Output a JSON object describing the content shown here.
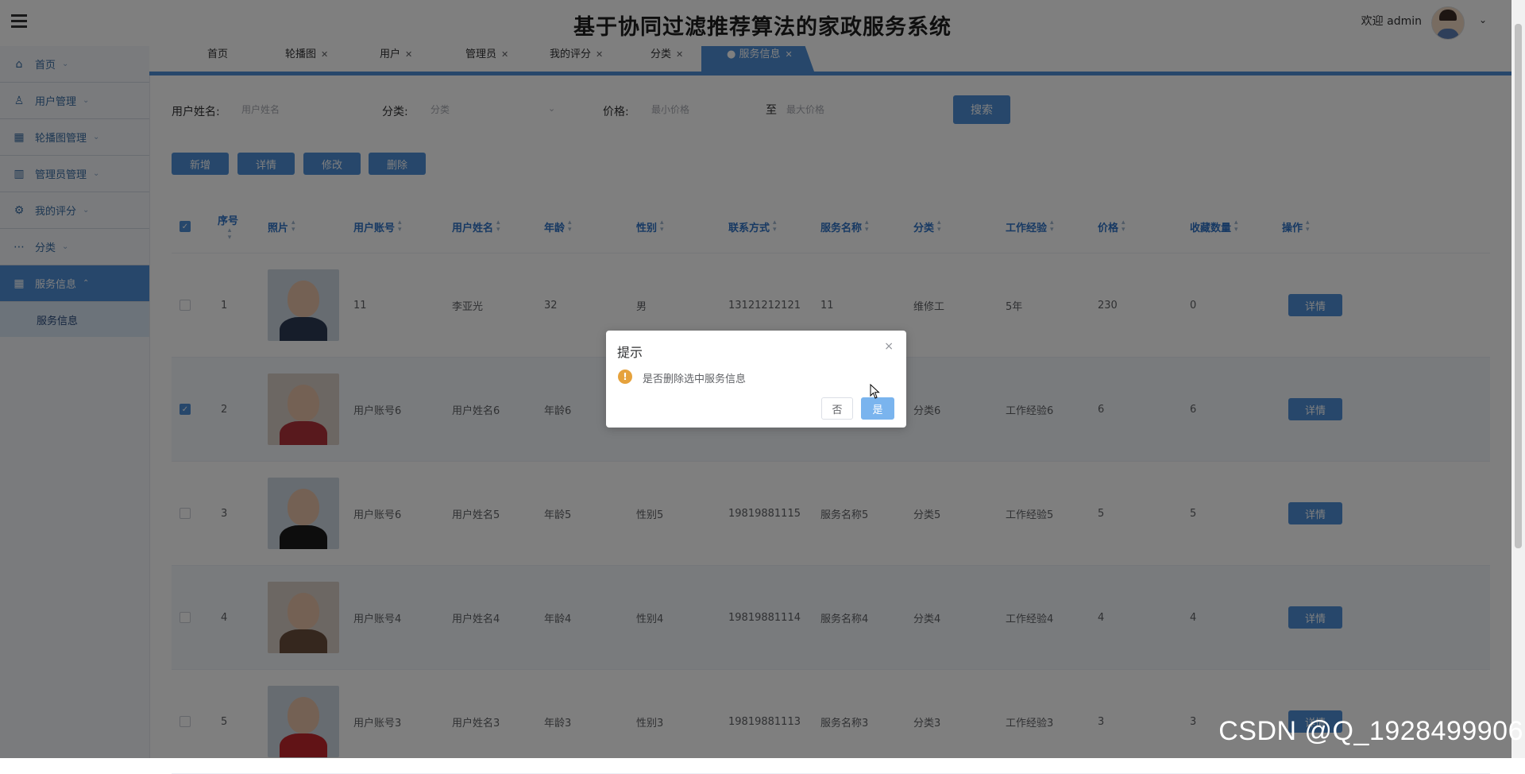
{
  "header": {
    "title": "基于协同过滤推荐算法的家政服务系统",
    "welcome": "欢迎 admin"
  },
  "sidebar": {
    "items": [
      {
        "label": "首页",
        "icon": "home-icon",
        "glyph": "⌂"
      },
      {
        "label": "用户管理",
        "icon": "user-icon",
        "glyph": "♙"
      },
      {
        "label": "轮播图管理",
        "icon": "grid-icon",
        "glyph": "▦"
      },
      {
        "label": "管理员管理",
        "icon": "dashboard-icon",
        "glyph": "▥"
      },
      {
        "label": "我的评分",
        "icon": "settings-icon",
        "glyph": "⚙"
      },
      {
        "label": "分类",
        "icon": "more-icon",
        "glyph": "⋯"
      },
      {
        "label": "服务信息",
        "icon": "grid-icon",
        "glyph": "▦"
      }
    ],
    "sub_item": "服务信息"
  },
  "tabs": [
    "首页",
    "轮播图",
    "用户",
    "管理员",
    "我的评分",
    "分类",
    "服务信息"
  ],
  "filters": {
    "name_label": "用户姓名:",
    "name_placeholder": "用户姓名",
    "category_label": "分类:",
    "category_placeholder": "分类",
    "price_label": "价格:",
    "min_placeholder": "最小价格",
    "range_sep": "至",
    "max_placeholder": "最大价格",
    "search": "搜索"
  },
  "actions": {
    "add": "新增",
    "detail": "详情",
    "edit": "修改",
    "delete": "删除"
  },
  "table": {
    "columns": [
      "序号",
      "照片",
      "用户账号",
      "用户姓名",
      "年龄",
      "性别",
      "联系方式",
      "服务名称",
      "分类",
      "工作经验",
      "价格",
      "收藏数量",
      "操作"
    ],
    "rows": [
      {
        "idx": "1",
        "account": "11",
        "name": "李亚光",
        "age": "32",
        "gender": "男",
        "phone": "13121212121",
        "service": "11",
        "category": "维修工",
        "experience": "5年",
        "price": "230",
        "favorites": "0",
        "checked": false,
        "cloth": "#2c3a55"
      },
      {
        "idx": "2",
        "account": "用户账号6",
        "name": "用户姓名6",
        "age": "年龄6",
        "gender": "",
        "phone": "",
        "service": "",
        "category": "分类6",
        "experience": "工作经验6",
        "price": "6",
        "favorites": "6",
        "checked": true,
        "cloth": "#b0323a"
      },
      {
        "idx": "3",
        "account": "用户账号6",
        "name": "用户姓名5",
        "age": "年龄5",
        "gender": "性别5",
        "phone": "19819881115",
        "service": "服务名称5",
        "category": "分类5",
        "experience": "工作经验5",
        "price": "5",
        "favorites": "5",
        "checked": false,
        "cloth": "#1a1a1a"
      },
      {
        "idx": "4",
        "account": "用户账号4",
        "name": "用户姓名4",
        "age": "年龄4",
        "gender": "性别4",
        "phone": "19819881114",
        "service": "服务名称4",
        "category": "分类4",
        "experience": "工作经验4",
        "price": "4",
        "favorites": "4",
        "checked": false,
        "cloth": "#6b4e3d"
      },
      {
        "idx": "5",
        "account": "用户账号3",
        "name": "用户姓名3",
        "age": "年龄3",
        "gender": "性别3",
        "phone": "19819881113",
        "service": "服务名称3",
        "category": "分类3",
        "experience": "工作经验3",
        "price": "3",
        "favorites": "3",
        "checked": false,
        "cloth": "#c2272d"
      }
    ],
    "detail_label": "详情"
  },
  "dialog": {
    "title": "提示",
    "message": "是否删除选中服务信息",
    "no": "否",
    "yes": "是",
    "close": "×"
  },
  "watermark": "CSDN @Q_1928499906",
  "colors": {
    "accent": "#4e8fd6",
    "warning": "#e6a23c",
    "overlay": "rgba(0,0,0,0.5)"
  }
}
